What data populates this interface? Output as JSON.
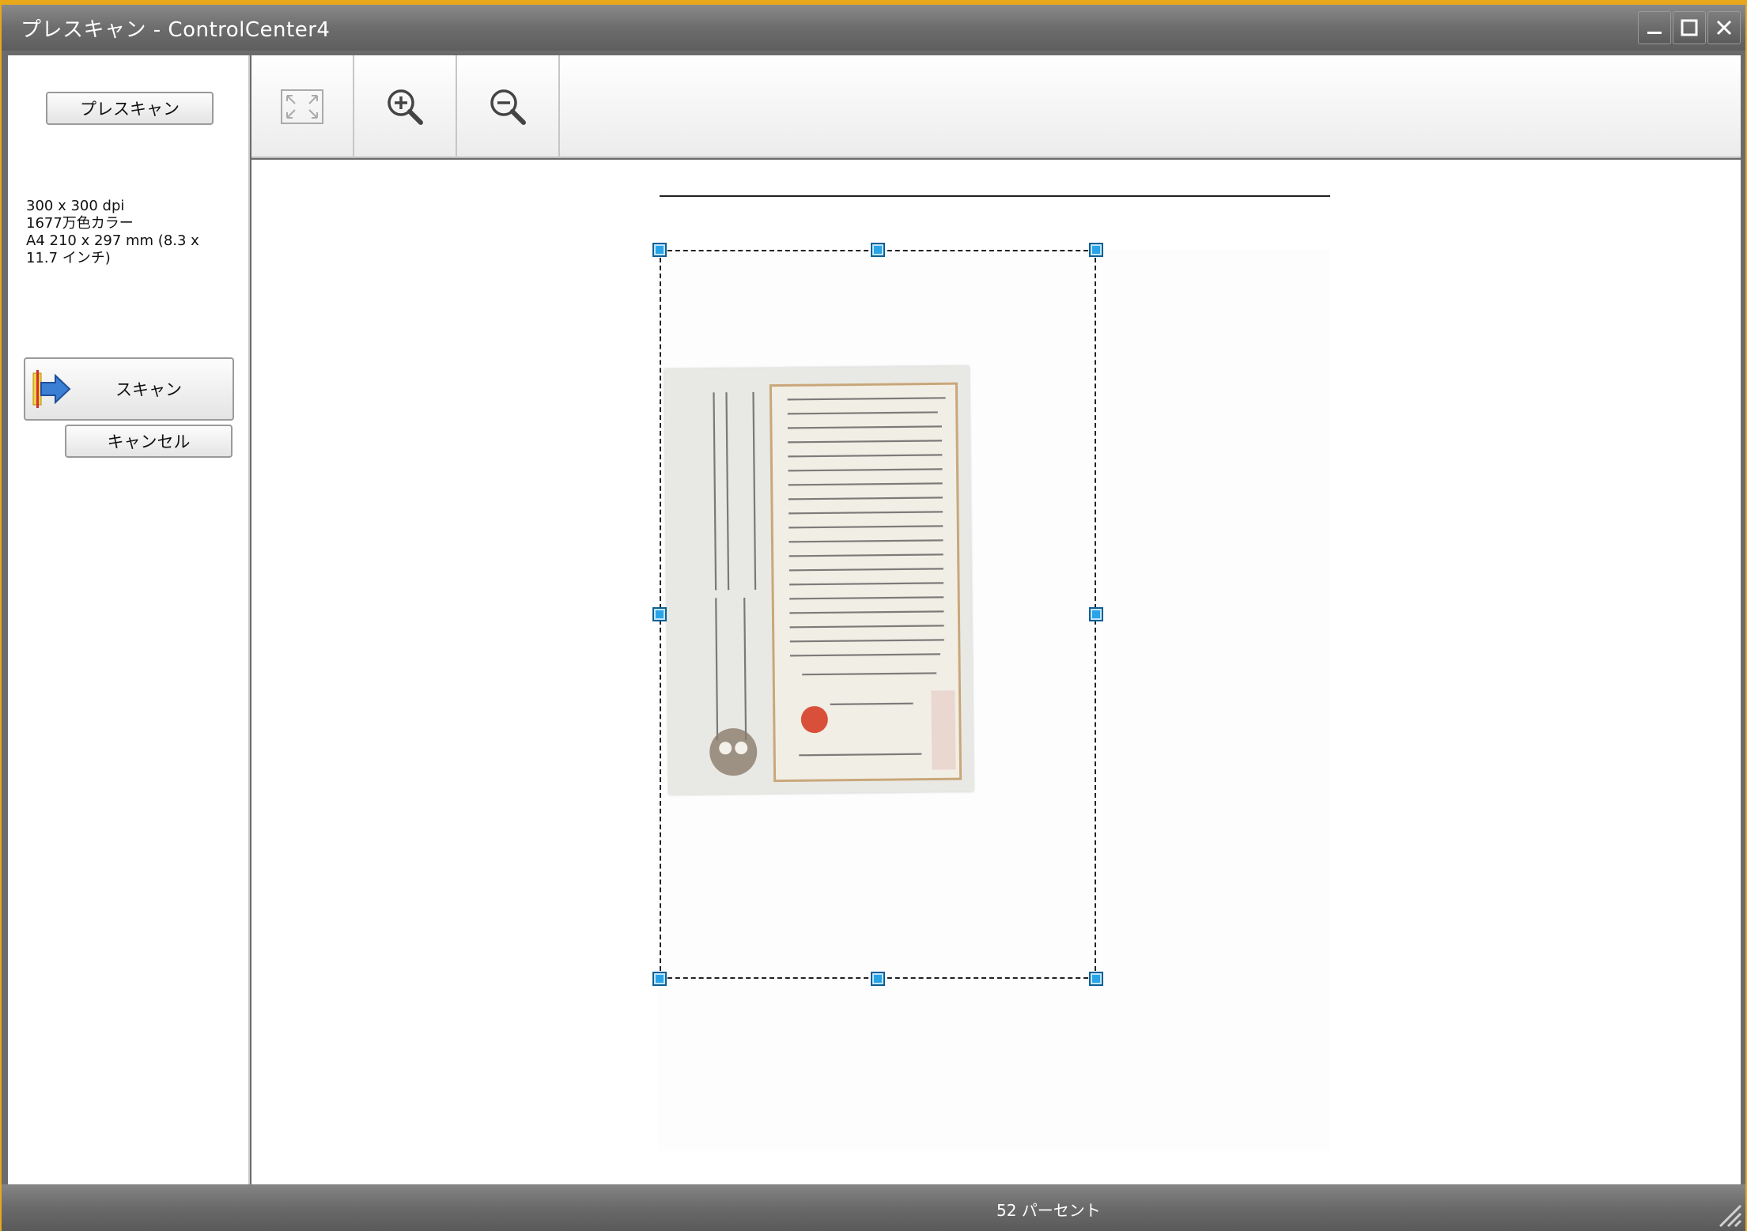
{
  "window": {
    "title": "プレスキャン - ControlCenter4"
  },
  "left_panel": {
    "prescan_label": "プレスキャン",
    "info": {
      "resolution": "300 x 300 dpi",
      "color": "1677万色カラー",
      "paper_line1": "A4 210 x 297 mm (8.3 x",
      "paper_line2": "11.7 インチ)"
    },
    "scan_label": "スキャン",
    "cancel_label": "キャンセル"
  },
  "toolbar": {
    "fit_icon": "fit-to-window-icon",
    "zoom_in_icon": "zoom-in-icon",
    "zoom_out_icon": "zoom-out-icon"
  },
  "preview": {
    "selection_handle_color": "#2aa4e6",
    "clipping_image": "newspaper-clipping"
  },
  "status": {
    "zoom": "52 パーセント"
  },
  "colors": {
    "title_border": "#e9a81a",
    "frame": "#6b6b6b"
  }
}
